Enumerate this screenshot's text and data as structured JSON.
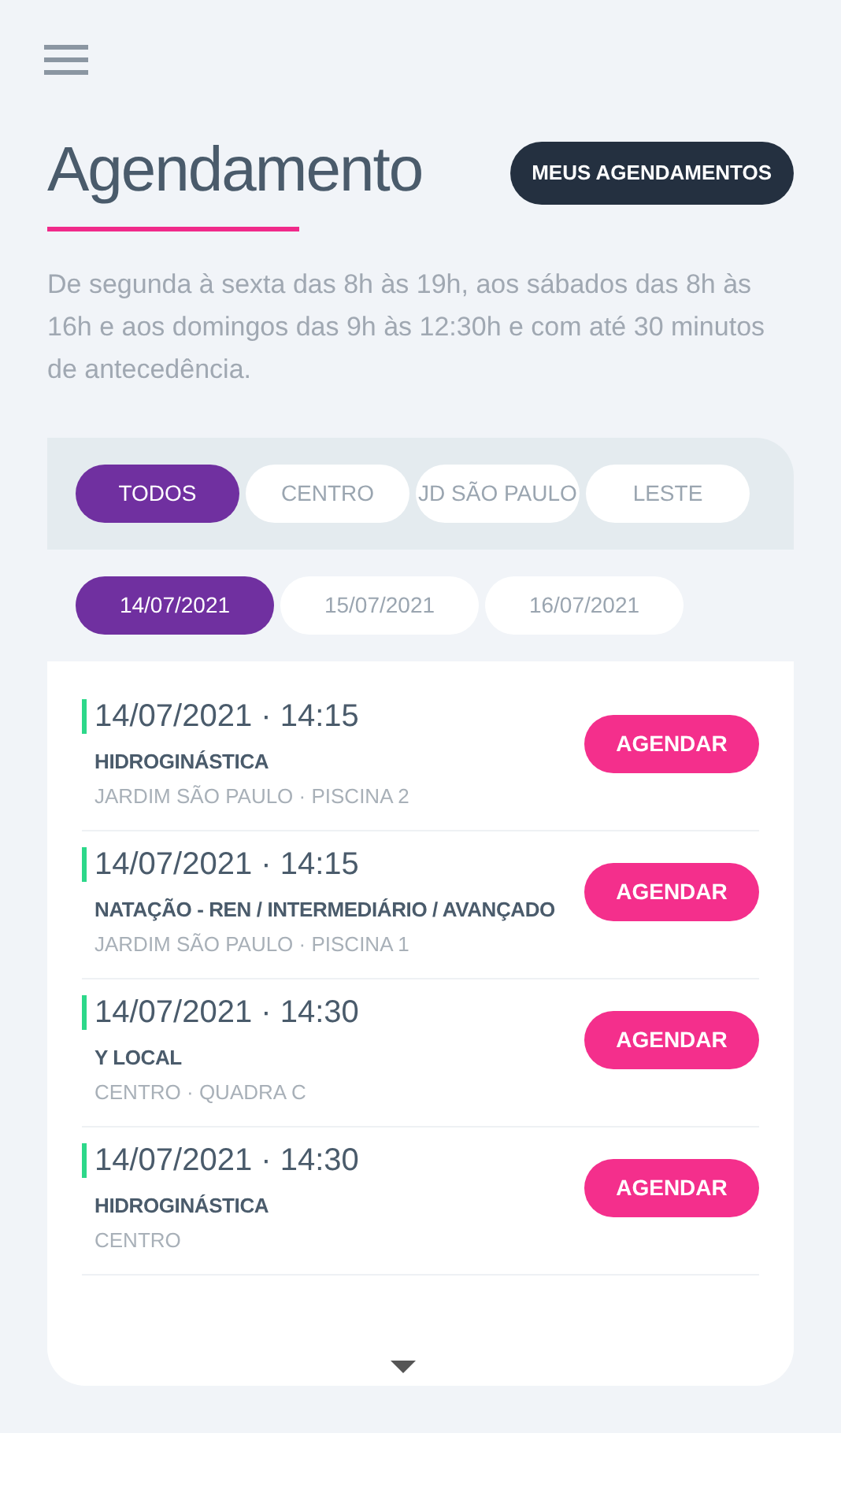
{
  "header": {
    "title": "Agendamento",
    "button": "MEUS AGENDAMENTOS"
  },
  "description": "De segunda à sexta das 8h às 19h, aos sábados das 8h às 16h e aos domingos das 9h às 12:30h e com até 30 minutos de antecedência.",
  "locations": [
    {
      "label": "TODOS",
      "selected": true
    },
    {
      "label": "CENTRO",
      "selected": false
    },
    {
      "label": "JD SÃO PAULO",
      "selected": false
    },
    {
      "label": "LESTE",
      "selected": false
    }
  ],
  "dates": [
    {
      "label": "14/07/2021",
      "selected": true
    },
    {
      "label": "15/07/2021",
      "selected": false
    },
    {
      "label": "16/07/2021",
      "selected": false
    }
  ],
  "classes": [
    {
      "datetime": "14/07/2021 · 14:15",
      "activity": "HIDROGINÁSTICA",
      "place": "JARDIM SÃO PAULO · PISCINA 2",
      "button": "AGENDAR"
    },
    {
      "datetime": "14/07/2021 · 14:15",
      "activity": "NATAÇÃO - REN / INTERMEDIÁRIO / AVANÇADO",
      "place": "JARDIM SÃO PAULO · PISCINA 1",
      "button": "AGENDAR"
    },
    {
      "datetime": "14/07/2021 · 14:30",
      "activity": "Y LOCAL",
      "place": "CENTRO · QUADRA C",
      "button": "AGENDAR"
    },
    {
      "datetime": "14/07/2021 · 14:30",
      "activity": "HIDROGINÁSTICA",
      "place": "CENTRO",
      "button": "AGENDAR"
    }
  ]
}
